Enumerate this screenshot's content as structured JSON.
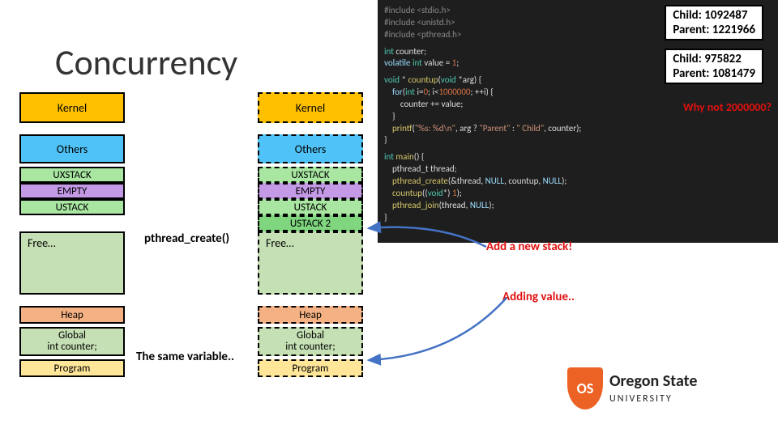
{
  "title": "Concurrency",
  "blocks": {
    "kernel": "Kernel",
    "others": "Others",
    "uxstack": "UXSTACK",
    "empty": "EMPTY",
    "ustack": "USTACK",
    "ustack2": "USTACK 2",
    "free": "Free…",
    "heap": "Heap",
    "global": "Global\nint counter;",
    "program": "Program"
  },
  "labels": {
    "pthread_create": "pthread_create()",
    "same_var": "The same variable..",
    "add_stack": "Add a new stack!",
    "adding_value": "Adding value..",
    "why_not": "Why not 2000000?"
  },
  "code": {
    "l1": "#include <stdio.h>",
    "l2": "#include <unistd.h>",
    "l3": "#include <pthread.h>",
    "l4": "int counter;",
    "l5": "volatile int value = 1;",
    "l6a": "void * countup(void *arg) {",
    "l6b": "    for(int i=0; i<1000000; ++i) {",
    "l6c": "        counter += value;",
    "l6d": "    }",
    "l6e": "    printf(\"%s: %d\\n\", arg ? \"Parent\" : \" Child\", counter);",
    "l6f": "}",
    "l7a": "int main() {",
    "l7b": "    pthread_t thread;",
    "l7c": "    pthread_create(&thread, NULL, countup, NULL);",
    "l7d": "    countup((void*) 1);",
    "l7e": "    pthread_join(thread, NULL);",
    "l7f": "}"
  },
  "output": {
    "o1a": " Child: 1092487",
    "o1b": "Parent: 1221966",
    "o2a": " Child: 975822",
    "o2b": "Parent: 1081479"
  },
  "logo": {
    "name": "Oregon State",
    "sub": "UNIVERSITY",
    "mark": "OS"
  }
}
